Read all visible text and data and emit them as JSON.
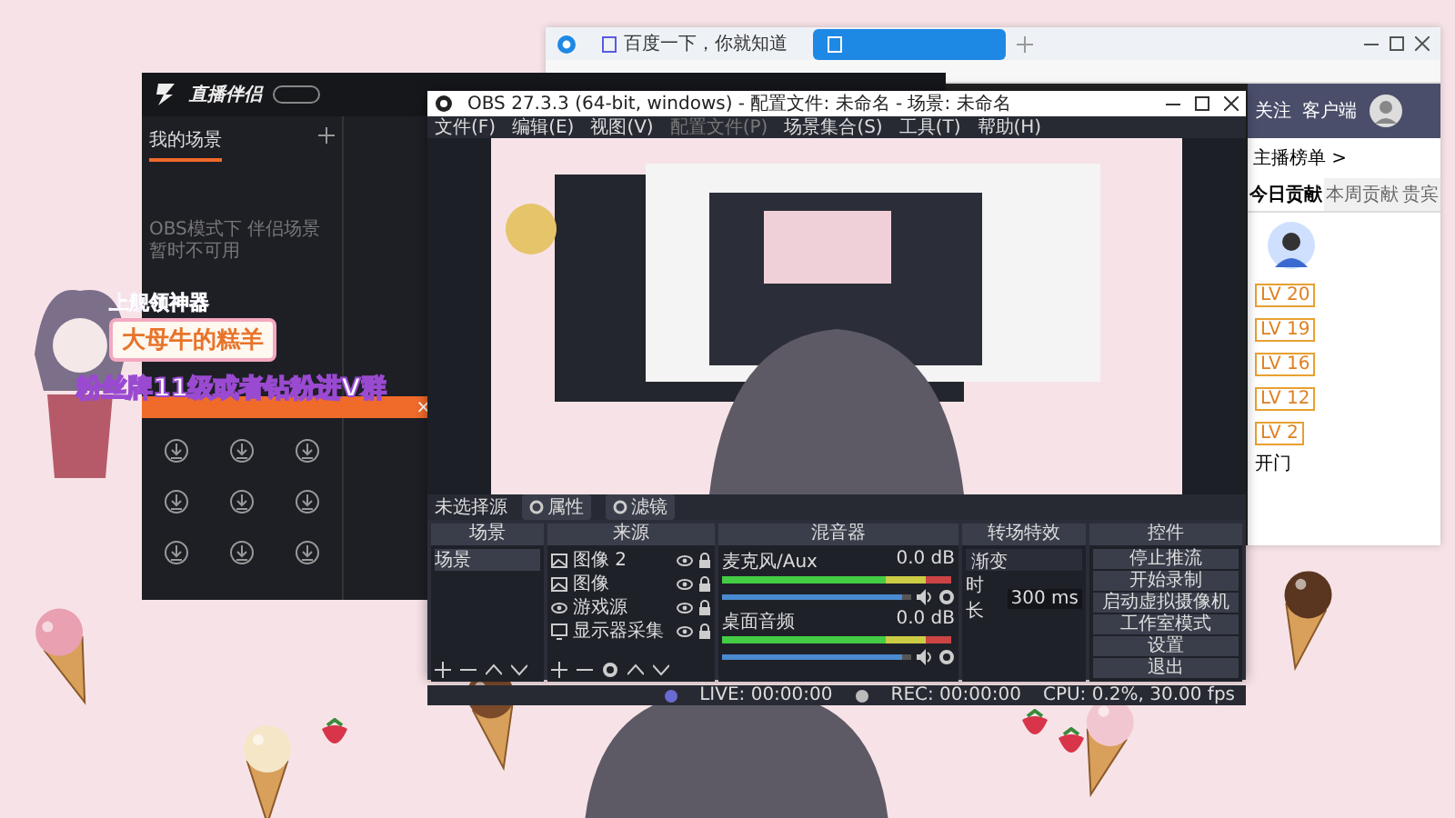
{
  "browser": {
    "tabs": [
      {
        "label": "百度一下，你就知道",
        "selected": false
      },
      {
        "selected": true
      }
    ]
  },
  "sidebar": {
    "header_links": [
      "关注",
      "客户端"
    ],
    "ranking_title": "主播榜单 >",
    "tabs": [
      {
        "label": "今日贡献",
        "selected": true
      },
      {
        "label": "本周贡献",
        "selected": false
      },
      {
        "label": "贵宾",
        "selected": false
      }
    ],
    "levels": [
      "LV 20",
      "LV 19",
      "LV 16",
      "LV 12",
      "LV 2"
    ],
    "extra": "开门"
  },
  "companion": {
    "logo": "直播伴侣",
    "tabs": [
      {
        "label": "我的场景",
        "selected": true
      }
    ],
    "notice": "OBS模式下 伴侣场景暂时不可用",
    "banner_close": "×"
  },
  "overlay": {
    "line_1": "上舰领神器",
    "line_2": "大母牛的糕羊",
    "line_3": "粉丝牌11级或者钻粉进V群"
  },
  "obs": {
    "title": "OBS 27.3.3 (64-bit, windows) - 配置文件: 未命名 - 场景: 未命名",
    "menu": [
      {
        "label": "文件(F)",
        "disabled": false
      },
      {
        "label": "编辑(E)",
        "disabled": false
      },
      {
        "label": "视图(V)",
        "disabled": false
      },
      {
        "label": "配置文件(P)",
        "disabled": true
      },
      {
        "label": "场景集合(S)",
        "disabled": false
      },
      {
        "label": "工具(T)",
        "disabled": false
      },
      {
        "label": "帮助(H)",
        "disabled": false
      }
    ],
    "source_bar": {
      "label": "未选择源",
      "buttons": [
        "属性",
        "滤镜"
      ]
    },
    "scenes": {
      "title": "场景",
      "items": [
        {
          "label": "场景",
          "selected": true
        }
      ]
    },
    "sources": {
      "title": "来源",
      "items": [
        {
          "label": "图像 2",
          "kind": "image"
        },
        {
          "label": "图像",
          "kind": "image"
        },
        {
          "label": "游戏源",
          "kind": "game"
        },
        {
          "label": "显示器采集",
          "kind": "display"
        }
      ]
    },
    "mixer": {
      "title": "混音器",
      "channels": [
        {
          "name": "麦克风/Aux",
          "reading": "0.0 dB",
          "level": 0.95
        },
        {
          "name": "桌面音频",
          "reading": "0.0 dB",
          "level": 0.95
        }
      ]
    },
    "transitions": {
      "title": "转场特效",
      "selected": "渐变",
      "duration_label": "时长",
      "duration": "300 ms"
    },
    "controls": {
      "title": "控件",
      "buttons": [
        "停止推流",
        "开始录制",
        "启动虚拟摄像机",
        "工作室模式",
        "设置",
        "退出"
      ]
    },
    "status": {
      "live": "LIVE: 00:00:00",
      "rec": "REC: 00:00:00",
      "cpu": "CPU: 0.2%, 30.00 fps"
    }
  }
}
